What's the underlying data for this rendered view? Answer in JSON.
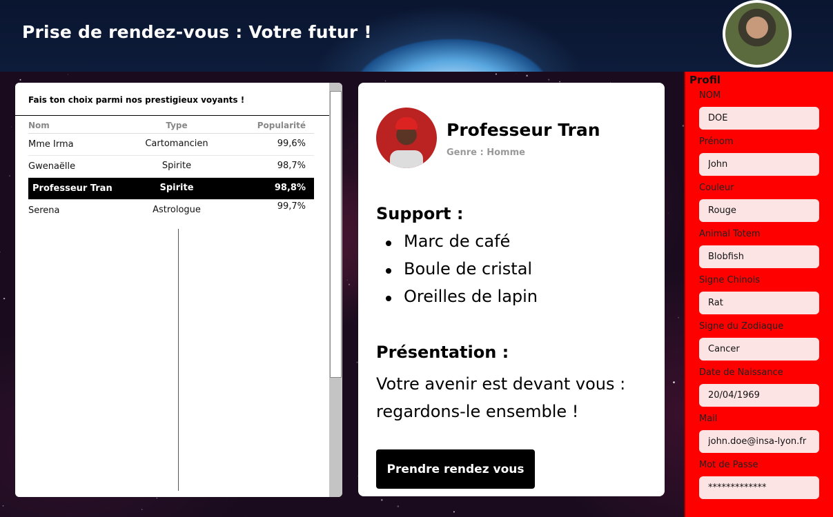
{
  "header": {
    "title": "Prise de rendez-vous : Votre futur !"
  },
  "list": {
    "caption": "Fais ton choix parmi nos prestigieux voyants !",
    "columns": [
      "Nom",
      "Type",
      "Popularité"
    ],
    "rows": [
      {
        "name": "Mme Irma",
        "type": "Cartomancien",
        "popularity": "99,6%"
      },
      {
        "name": "Gwenaëlle",
        "type": "Spirite",
        "popularity": "98,7%"
      },
      {
        "name": "Professeur Tran",
        "type": "Spirite",
        "popularity": "98,8%",
        "selected": true
      },
      {
        "name": "Serena",
        "type": "Astrologue",
        "popularity": "99,7%"
      }
    ]
  },
  "detail": {
    "name": "Professeur Tran",
    "gender": "Genre : Homme",
    "support_title": "Support :",
    "support_items": [
      "Marc de café",
      "Boule de cristal",
      "Oreilles de lapin"
    ],
    "presentation_title": "Présentation :",
    "presentation_text": "Votre avenir est devant vous : regardons-le ensemble !",
    "button_label": "Prendre rendez vous"
  },
  "profile": {
    "title": "Profil",
    "fields": [
      {
        "label": "NOM",
        "value": "DOE"
      },
      {
        "label": "Prénom",
        "value": "John"
      },
      {
        "label": "Couleur",
        "value": "Rouge"
      },
      {
        "label": "Animal Totem",
        "value": "Blobfish"
      },
      {
        "label": "Signe Chinois",
        "value": "Rat"
      },
      {
        "label": "Signe du Zodiaque",
        "value": "Cancer"
      },
      {
        "label": "Date de Naissance",
        "value": "20/04/1969"
      },
      {
        "label": "Mail",
        "value": "john.doe@insa-lyon.fr"
      },
      {
        "label": "Mot de Passe",
        "value": "*************"
      }
    ]
  },
  "colors": {
    "profile_bg": "#ff0000",
    "input_bg": "#fde4e4",
    "selected_row_bg": "#000000",
    "button_bg": "#000000"
  }
}
